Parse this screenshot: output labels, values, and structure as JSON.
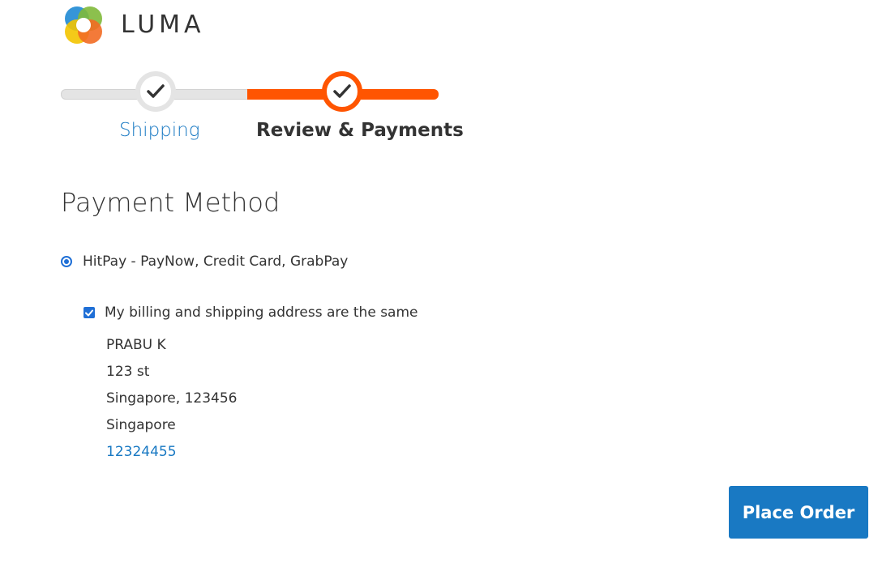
{
  "brand": {
    "logo_text": "LUMA",
    "colors": {
      "logo_blue": "#2a8fd6",
      "logo_green": "#7fb93a",
      "logo_yellow": "#f3c400",
      "logo_orange": "#f26c23"
    }
  },
  "progress": {
    "steps": [
      {
        "label": "Shipping",
        "state": "complete",
        "icon": "checkmark-icon"
      },
      {
        "label": "Review & Payments",
        "state": "active",
        "icon": "checkmark-icon"
      }
    ],
    "colors": {
      "active": "#ff5501",
      "complete_track": "#e4e4e4",
      "link": "#1979c3"
    }
  },
  "payment": {
    "title": "Payment Method",
    "method_label": "HitPay - PayNow, Credit Card, GrabPay",
    "method_selected": true,
    "billing_same_label": "My billing and shipping address are the same",
    "billing_same_checked": true,
    "address": {
      "name": "PRABU K",
      "street": "123 st",
      "city_postcode": "Singapore, 123456",
      "country": "Singapore",
      "phone": "12324455"
    },
    "place_order_label": "Place Order",
    "button_color": "#1979c3"
  }
}
